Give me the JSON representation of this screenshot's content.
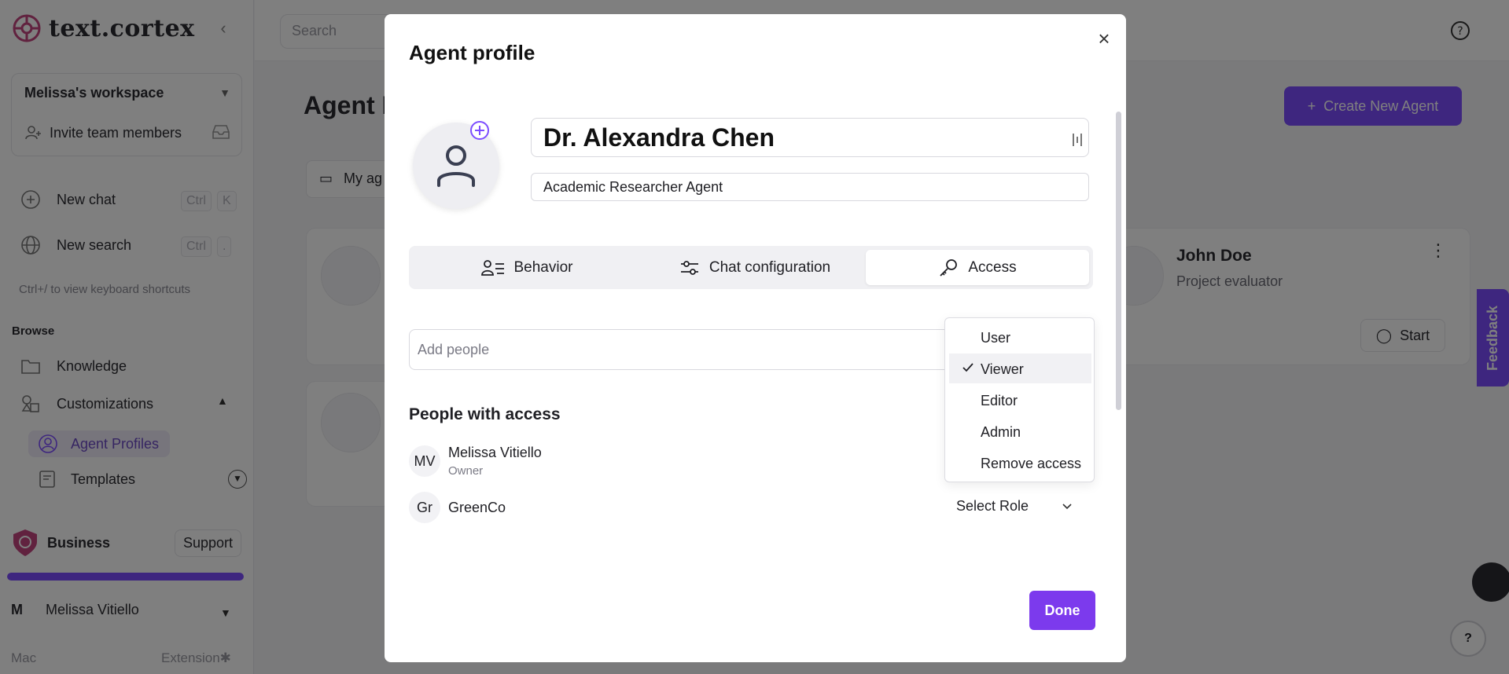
{
  "app": {
    "logo_text": "text.cortex"
  },
  "sidebar": {
    "workspace_name": "Melissa's workspace",
    "invite_label": "Invite team members",
    "new_chat": {
      "label": "New chat",
      "kbd1": "Ctrl",
      "kbd2": "K"
    },
    "new_search": {
      "label": "New search",
      "kbd1": "Ctrl",
      "kbd2": "."
    },
    "shortcut_hint": "Ctrl+/ to view keyboard shortcuts",
    "browse_label": "Browse",
    "knowledge": "Knowledge",
    "customizations": "Customizations",
    "agent_profiles": "Agent Profiles",
    "templates": "Templates",
    "plan": "Business",
    "support": "Support",
    "usage_fraction": 1.0,
    "user_initial": "M",
    "user_name": "Melissa Vitiello",
    "footer_mac": "Mac",
    "footer_extension": "Extension"
  },
  "topbar": {
    "search_placeholder": "Search"
  },
  "main": {
    "title": "Agent P",
    "create_button": "Create New Agent",
    "folder_chip": "My ag",
    "card": {
      "name": "John Doe",
      "role": "Project evaluator",
      "start": "Start"
    },
    "feedback": "Feedback",
    "help_fab": "?"
  },
  "modal": {
    "title": "Agent profile",
    "agent_name": "Dr. Alexandra Chen",
    "agent_role": "Academic Researcher Agent",
    "tabs": [
      {
        "label": "Behavior"
      },
      {
        "label": "Chat configuration"
      },
      {
        "label": "Access"
      }
    ],
    "add_people_placeholder": "Add people",
    "people_title": "People with access",
    "people": [
      {
        "initials": "MV",
        "name": "Melissa Vitiello",
        "sub": "Owner"
      },
      {
        "initials": "Gr",
        "name": "GreenCo",
        "role": "Select Role"
      }
    ],
    "role_options": [
      "User",
      "Viewer",
      "Editor",
      "Admin",
      "Remove access"
    ],
    "selected_role": "Viewer",
    "done": "Done"
  },
  "colors": {
    "accent": "#7c4dff",
    "done": "#7c3aed"
  }
}
